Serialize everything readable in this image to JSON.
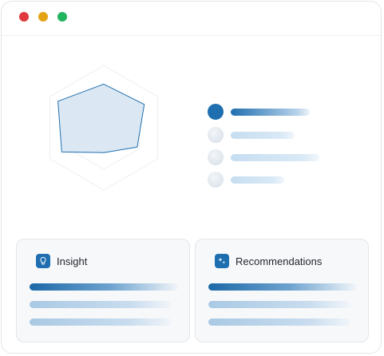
{
  "window": {
    "controls": [
      "close",
      "minimize",
      "maximize"
    ],
    "control_colors": {
      "close": "#e0393e",
      "minimize": "#e3a314",
      "maximize": "#22b45e"
    }
  },
  "colors": {
    "accent": "#1f6fb0",
    "accent_light": "#c9dff0",
    "radar_fill": "#dbe8f3",
    "grid": "#eceef1"
  },
  "chart_data": {
    "type": "radar",
    "axes_count": 6,
    "grid_rings": 3,
    "series": [
      {
        "values": [
          0.85,
          0.7,
          0.75,
          0.62,
          0.4,
          0.78
        ]
      }
    ],
    "rmax": 1
  },
  "legend": {
    "items": [
      {
        "active": true,
        "bar_level": 0.66
      },
      {
        "active": false,
        "bar_level": 0.53
      },
      {
        "active": false,
        "bar_level": 0.74
      },
      {
        "active": false,
        "bar_level": 0.45
      }
    ]
  },
  "cards": [
    {
      "title": "Insight",
      "icon": "lightbulb-icon",
      "bars": [
        {
          "style": "primary"
        },
        {
          "style": "secondary"
        },
        {
          "style": "secondary"
        }
      ]
    },
    {
      "title": "Recommendations",
      "icon": "sparkles-icon",
      "bars": [
        {
          "style": "primary"
        },
        {
          "style": "secondary"
        },
        {
          "style": "secondary"
        }
      ]
    }
  ]
}
